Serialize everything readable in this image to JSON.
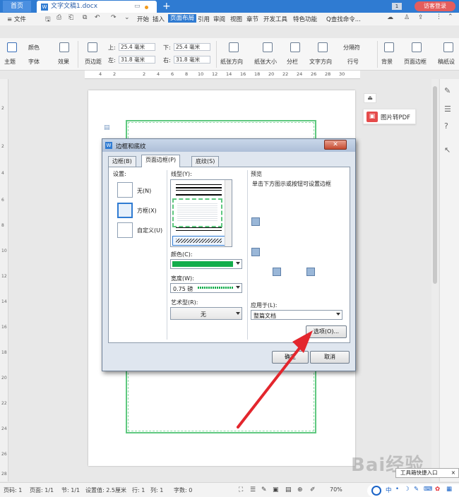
{
  "tabs": {
    "home": "首页",
    "doc": "文字文稿1.docx",
    "add": "+",
    "doc_icon": "W"
  },
  "titlebar": {
    "badge": "1",
    "login": "访客登录",
    "monitor_icon": "monitor-icon"
  },
  "menu": {
    "file": "≡ 文件",
    "items": [
      "开始",
      "插入",
      "页面布局",
      "引用",
      "审阅",
      "视图",
      "章节",
      "开发工具",
      "特色功能"
    ],
    "active": "页面布局",
    "search": "Q查找命令..."
  },
  "ribbon": {
    "theme": "主题",
    "color": "颜色",
    "font": "字体",
    "effect": "效果",
    "margin": "页边距",
    "top_label": "上:",
    "top_value": "25.4 毫米",
    "bottom_label": "下:",
    "bottom_value": "25.4 毫米",
    "left_label": "左:",
    "left_value": "31.8 毫米",
    "right_label": "右:",
    "right_value": "31.8 毫米",
    "orientation": "纸张方向",
    "size": "纸张大小",
    "columns": "分栏",
    "text_dir": "文字方向",
    "separator": "分隔符",
    "line_num": "行号",
    "background": "背景",
    "page_border": "页面边框",
    "manuscript": "稿纸设"
  },
  "ruler": [
    "4",
    "2",
    "2",
    "4",
    "6",
    "8",
    "10",
    "12",
    "14",
    "16",
    "18",
    "20",
    "22",
    "24",
    "26",
    "28",
    "30"
  ],
  "vruler": [
    "2",
    "2",
    "4",
    "6",
    "8",
    "10",
    "12",
    "14",
    "16",
    "18",
    "20",
    "22",
    "24",
    "26",
    "28"
  ],
  "pdf": {
    "label": "图片转PDF"
  },
  "dialog": {
    "title": "边框和底纹",
    "tabs": [
      "边框(B)",
      "页面边框(P)",
      "底纹(S)"
    ],
    "active_tab": "页面边框(P)",
    "settings_label": "设置:",
    "settings": [
      "无(N)",
      "方框(X)",
      "自定义(U)"
    ],
    "line_style_label": "线型(Y):",
    "color_label": "颜色(C):",
    "color_value": "#13ad4c",
    "width_label": "宽度(W):",
    "width_value": "0.75 磅",
    "art_label": "艺术型(R):",
    "art_value": "无",
    "preview_label": "预览",
    "preview_hint": "单击下方图示或按钮可设置边框",
    "apply_label": "应用于(L):",
    "apply_value": "整篇文档",
    "options_button": "选项(O)...",
    "ok_button": "确定",
    "cancel_button": "取消"
  },
  "status": {
    "page_num": "页码: 1",
    "page": "页面: 1/1",
    "section": "节: 1/1",
    "setting": "设置值: 2.5厘米",
    "row": "行: 1",
    "col": "列: 1",
    "chars": "字数: 0",
    "zoom": "70%"
  },
  "toolbox": "工具箱快捷入口",
  "ime": {
    "zh": "中",
    "dot": "•",
    "moon": "☽",
    "mic": "✎",
    "keyboard": "⌨"
  },
  "watermark": "Bai经验"
}
